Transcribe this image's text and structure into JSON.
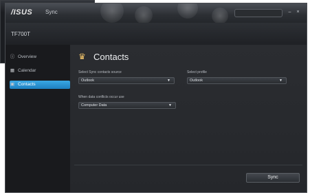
{
  "titlebar": {
    "logo": "/ISUS",
    "app_name": "Sync",
    "search_placeholder": "",
    "minimize_symbol": "–",
    "close_symbol": "×"
  },
  "device": {
    "name": "TF700T"
  },
  "sidebar": {
    "items": [
      {
        "label": "Overview",
        "icon": "info-circle-icon"
      },
      {
        "label": "Calendar",
        "icon": "calendar-icon"
      },
      {
        "label": "Contacts",
        "icon": "contacts-icon",
        "active": true
      }
    ]
  },
  "content": {
    "title": "Contacts",
    "source_label": "Select Sync contacts source",
    "source_value": "Outlook",
    "profile_label": "Select profile",
    "profile_value": "Outlook",
    "conflict_label": "When data conflicts occur use",
    "conflict_value": "Computer Data",
    "sync_button": "Sync"
  },
  "colors": {
    "accent": "#2a8fd0",
    "background": "#17181b"
  }
}
